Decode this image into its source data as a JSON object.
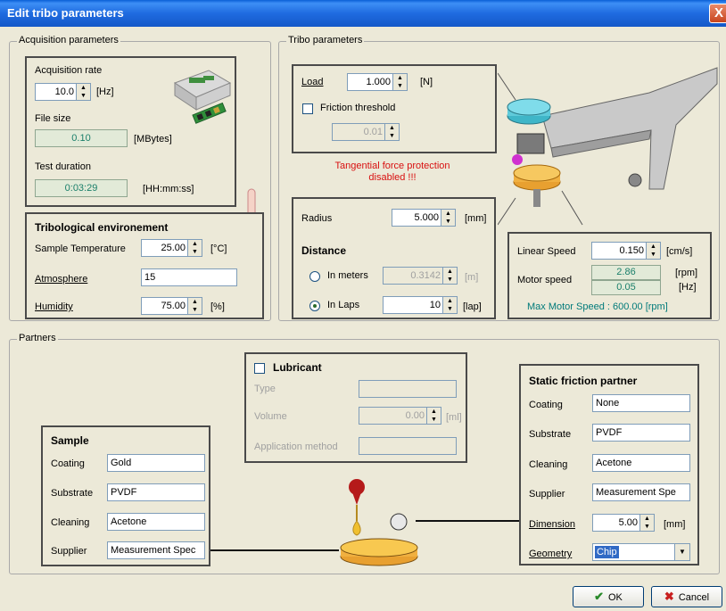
{
  "window": {
    "title": "Edit tribo parameters",
    "close_glyph": "X"
  },
  "acquisition": {
    "group_label": "Acquisition parameters",
    "rate_label": "Acquisition rate",
    "rate_value": "10.0",
    "rate_unit": "[Hz]",
    "file_size_label": "File size",
    "file_size_value": "0.10",
    "file_size_unit": "[MBytes]",
    "duration_label": "Test duration",
    "duration_value": "0:03:29",
    "duration_unit": "[HH:mm:ss]"
  },
  "environment": {
    "title": "Tribological environement",
    "temp_label": "Sample Temperature",
    "temp_value": "25.00",
    "temp_unit": "[°C]",
    "atmosphere_label": "Atmosphere",
    "atmosphere_value": "15",
    "humidity_label": "Humidity",
    "humidity_value": "75.00",
    "humidity_unit": "[%]"
  },
  "tribo": {
    "group_label": "Tribo parameters",
    "load_label": "Load",
    "load_value": "1.000",
    "load_unit": "[N]",
    "friction_label": "Friction threshold",
    "friction_value": "0.01",
    "warning": "Tangential force protection\ndisabled !!!",
    "radius_label": "Radius",
    "radius_value": "5.000",
    "radius_unit": "[mm]",
    "distance_title": "Distance",
    "meters_label": "In meters",
    "meters_value": "0.3142",
    "meters_unit": "[m]",
    "laps_label": "In Laps",
    "laps_value": "10",
    "laps_unit": "[lap]",
    "linear_label": "Linear Speed",
    "linear_value": "0.150",
    "linear_unit": "[cm/s]",
    "motor_label": "Motor speed",
    "motor_rpm": "2.86",
    "motor_rpm_unit": "[rpm]",
    "motor_hz": "0.05",
    "motor_hz_unit": "[Hz]",
    "max_motor": "Max Motor Speed : 600.00 [rpm]"
  },
  "partners": {
    "group_label": "Partners",
    "lubricant": {
      "title": "Lubricant",
      "type_label": "Type",
      "volume_label": "Volume",
      "volume_value": "0.00",
      "volume_unit": "[ml]",
      "method_label": "Application method"
    },
    "sample": {
      "title": "Sample",
      "coating_label": "Coating",
      "coating_value": "Gold",
      "substrate_label": "Substrate",
      "substrate_value": "PVDF",
      "cleaning_label": "Cleaning",
      "cleaning_value": "Acetone",
      "supplier_label": "Supplier",
      "supplier_value": "Measurement Spec"
    },
    "static": {
      "title": "Static friction partner",
      "coating_label": "Coating",
      "coating_value": "None",
      "substrate_label": "Substrate",
      "substrate_value": "PVDF",
      "cleaning_label": "Cleaning",
      "cleaning_value": "Acetone",
      "supplier_label": "Supplier",
      "supplier_value": "Measurement Spe",
      "dimension_label": "Dimension",
      "dimension_value": "5.00",
      "dimension_unit": "[mm]",
      "geometry_label": "Geometry",
      "geometry_value": "Chip"
    }
  },
  "buttons": {
    "ok": "OK",
    "cancel": "Cancel"
  }
}
